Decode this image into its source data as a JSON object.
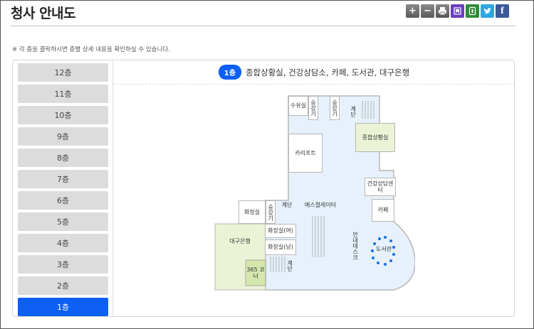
{
  "page": {
    "title": "청사 안내도"
  },
  "toolbar": {
    "zoom_in": "+",
    "zoom_out": "−",
    "print_icon": "print-icon",
    "bookmark_icon": "bookmark-icon",
    "share_icon": "share-icon",
    "twitter_icon": "twitter-icon",
    "facebook_label": "f"
  },
  "notice": "※ 각 층을 클릭하시면 층별 상세 내용을 확인하실 수 있습니다.",
  "floors": [
    "12층",
    "11층",
    "10층",
    "9층",
    "8층",
    "7층",
    "6층",
    "5층",
    "4층",
    "3층",
    "2층",
    "1층"
  ],
  "selected_floor": "1층",
  "floor_header": {
    "badge": "1층",
    "description": "종합상황실, 건강상담소, 카페, 도서관, 대구은행"
  },
  "map": {
    "rooms": {
      "water": "수유실",
      "lift1": "승강기",
      "lift2": "승강기",
      "stairs_top": "계단",
      "situation": "종합상황실",
      "carrier": "카리프트",
      "health": "건강상담센터",
      "escalator": "에스컬레이터",
      "restroom_left": "화장실",
      "lift3": "승강기",
      "stairs_mid": "계단",
      "cafe": "카페",
      "restroom_women": "화장실(여)",
      "restroom_men": "화장실(남)",
      "info_desk": "안내데스크",
      "library": "도서관",
      "bank": "대구은행",
      "corner365": "365 코너",
      "stairs_bottom": "계단"
    }
  },
  "colors": {
    "accent": "#0d5ff5",
    "floor_bg": "#dcdcdc",
    "map_fill": "#e6f1fb",
    "green_room": "#ebf3d6",
    "corner365": "#d6e7ad"
  }
}
